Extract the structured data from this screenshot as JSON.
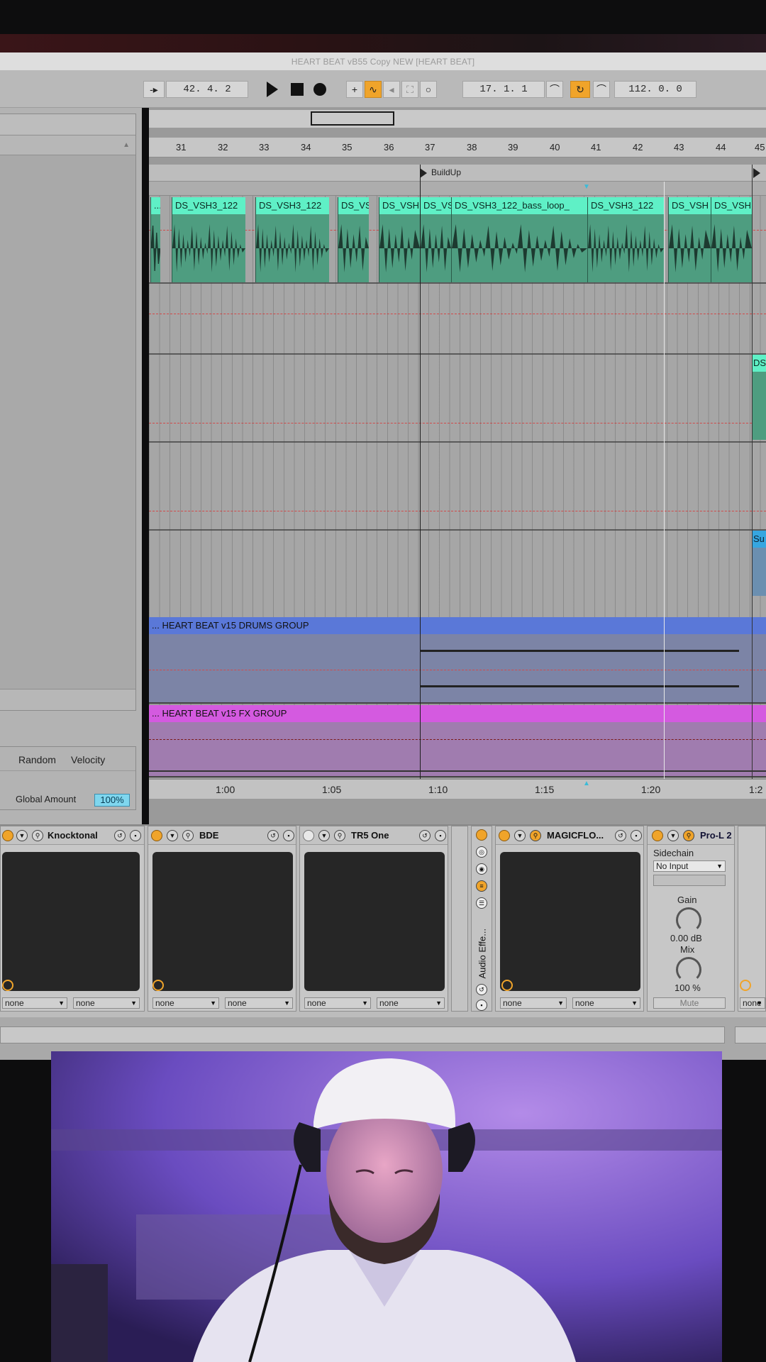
{
  "window": {
    "title": "HEART BEAT vB55 Copy NEW  [HEART BEAT]"
  },
  "transport": {
    "arrangement_position": "42.   4.   2",
    "loop_start": "17.   1.   1",
    "loop_length": "112.   0.   0"
  },
  "browser": {
    "groove_labels": {
      "random": "Random",
      "velocity": "Velocity"
    },
    "global_amount_label": "Global Amount",
    "global_amount_value": "100%"
  },
  "ruler": {
    "bars": [
      "31",
      "32",
      "33",
      "34",
      "35",
      "36",
      "37",
      "38",
      "39",
      "40",
      "41",
      "42",
      "43",
      "44",
      "45"
    ]
  },
  "locators": [
    {
      "label": "BuildUp"
    }
  ],
  "clips": [
    {
      "name": "..."
    },
    {
      "name": "DS_VSH3_122"
    },
    {
      "name": "DS_VSH3_122"
    },
    {
      "name": "DS_VS"
    },
    {
      "name": "DS_VSH"
    },
    {
      "name": "DS_VS"
    },
    {
      "name": "DS_VSH3_122_bass_loop_"
    },
    {
      "name": "DS_VSH3_122"
    },
    {
      "name": "DS_VSH"
    },
    {
      "name": "DS_VSH"
    }
  ],
  "right_edge_clips": {
    "ds": "DS",
    "su": "Su"
  },
  "groups": [
    {
      "name": "... HEART BEAT v15 DRUMS GROUP",
      "color": "#5a78d8"
    },
    {
      "name": "... HEART BEAT v15 FX GROUP",
      "color": "#d45ae0"
    }
  ],
  "time_ruler": [
    "1:00",
    "1:05",
    "1:10",
    "1:15",
    "1:20",
    "1:2"
  ],
  "devices": [
    {
      "name": "Knocktonal",
      "sel1": "none",
      "sel2": "none"
    },
    {
      "name": "BDE",
      "sel1": "none",
      "sel2": "none"
    },
    {
      "name": "TR5 One",
      "sel1": "none",
      "sel2": "none"
    },
    {
      "name": "MAGICFLO...",
      "sel1": "none",
      "sel2": "none"
    }
  ],
  "audio_effect_rack": {
    "label": "Audio Effe..."
  },
  "pro_l2": {
    "name": "Pro-L 2",
    "sidechain_label": "Sidechain",
    "sidechain_value": "No Input",
    "gain_label": "Gain",
    "gain_value": "0.00 dB",
    "mix_label": "Mix",
    "mix_value": "100 %",
    "mute_label": "Mute",
    "next_sel": "none"
  },
  "colors": {
    "clip_audio": "#4e9d80",
    "clip_header": "#5ff0c6",
    "accent_orange": "#f0a42a"
  }
}
